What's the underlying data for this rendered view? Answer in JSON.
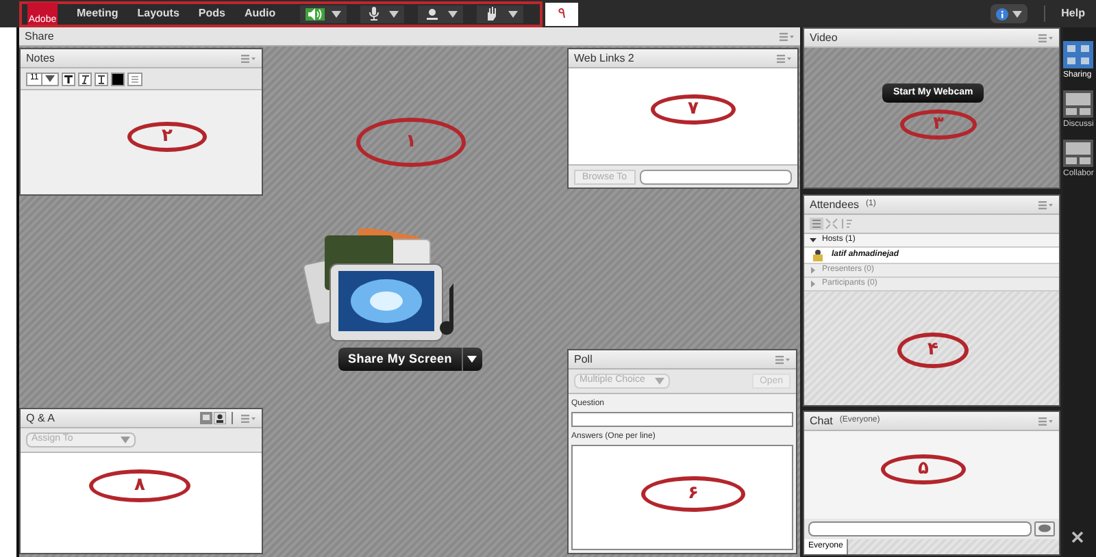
{
  "menubar": {
    "logo_text": "Adobe",
    "menus": [
      "Meeting",
      "Layouts",
      "Pods",
      "Audio"
    ],
    "tools": [
      {
        "kind": "speaker",
        "on": true
      },
      {
        "kind": "microphone",
        "on": false
      },
      {
        "kind": "webcam",
        "on": false
      },
      {
        "kind": "hand",
        "on": false
      }
    ],
    "annotation": "۹",
    "help": "Help"
  },
  "share": {
    "title": "Share",
    "button": "Share My Screen",
    "annotation": "۱"
  },
  "notes": {
    "title": "Notes",
    "font_size": "11",
    "annotation": "۲"
  },
  "web_links": {
    "title": "Web Links 2",
    "button": "Browse To",
    "annotation": "۷"
  },
  "qa": {
    "title": "Q & A",
    "assign": "Assign To",
    "annotation": "۸"
  },
  "poll": {
    "title": "Poll",
    "type": "Multiple Choice",
    "button": "Open",
    "question_label": "Question",
    "answers_label": "Answers (One per line)",
    "annotation": "۶"
  },
  "video": {
    "title": "Video",
    "button": "Start My Webcam",
    "annotation": "۳"
  },
  "attendees": {
    "title": "Attendees",
    "count": "(1)",
    "groups": [
      {
        "label": "Hosts (1)",
        "expanded": true,
        "children": [
          {
            "name": "latif ahmadinejad"
          }
        ]
      },
      {
        "label": "Presenters (0)",
        "expanded": false
      },
      {
        "label": "Participants (0)",
        "expanded": false
      }
    ],
    "annotation": "۴"
  },
  "chat": {
    "title": "Chat",
    "scope": "(Everyone)",
    "tab": "Everyone",
    "annotation": "۵"
  },
  "layouts": [
    {
      "label": "Sharing",
      "selected": true
    },
    {
      "label": "Discussi",
      "selected": false
    },
    {
      "label": "Collabor",
      "selected": false
    }
  ]
}
